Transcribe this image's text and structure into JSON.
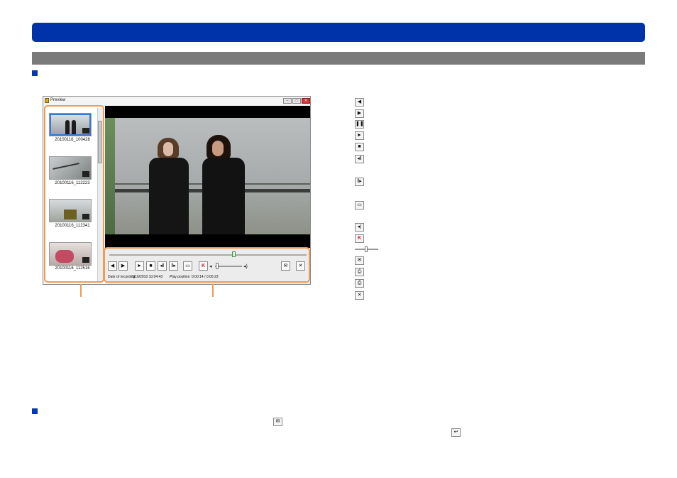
{
  "window": {
    "title": "Preview"
  },
  "thumbnails": [
    {
      "caption": "20100116_100428"
    },
    {
      "caption": "20100116_112223"
    },
    {
      "caption": "20100116_112341"
    },
    {
      "caption": "20100116_112516"
    }
  ],
  "status": {
    "date_label": "Date of recording",
    "date_value": "1/16/2010 10:04:43",
    "pos_label": "Play position",
    "pos_value": "0:00:14 / 0:00:23"
  },
  "icons": {
    "window_control": [
      "minimize-icon",
      "maximize-icon",
      "close-icon"
    ],
    "controls": [
      "previous-icon",
      "next-icon",
      "play-icon",
      "stop-icon",
      "frame-back-icon",
      "frame-forward-icon",
      "capture-icon",
      "bookmark-icon",
      "volume-icon",
      "email-icon",
      "close-icon"
    ],
    "legend": [
      "previous-icon",
      "next-icon",
      "pause-icon",
      "play-icon",
      "stop-icon",
      "frame-back-icon",
      "frame-forward-icon",
      "capture-icon",
      "volume-icon",
      "bookmark-icon",
      "volume-slider-icon",
      "email-icon",
      "print-icon",
      "print-icon",
      "close-icon"
    ]
  },
  "colors": {
    "title_bar": "#0033aa",
    "sub_bar": "#7a7a7a",
    "bullet": "#0039b8",
    "highlight": "#f29a52"
  }
}
